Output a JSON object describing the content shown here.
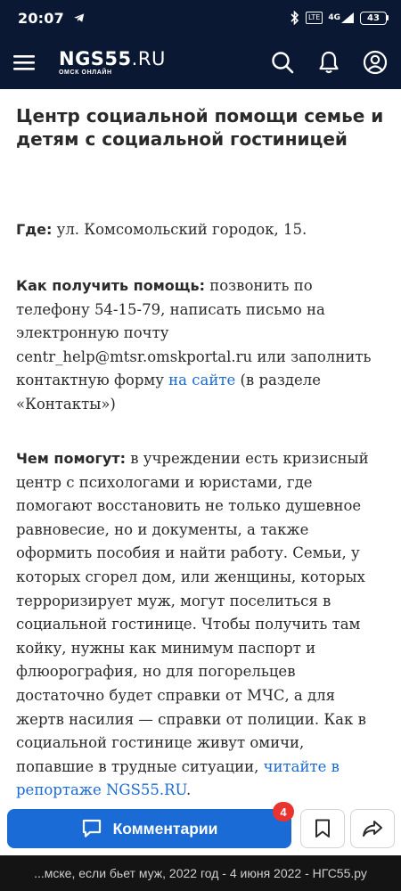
{
  "status_bar": {
    "time": "20:07",
    "network": "4G",
    "lte": "LTE",
    "battery": "43"
  },
  "header": {
    "logo_main": "NGS55",
    "logo_suffix": ".RU",
    "logo_sub": "ОМСК ОНЛАЙН"
  },
  "article": {
    "title": "Центр социальной помощи семье и детям с социальной гостиницей",
    "where_label": "Где:",
    "where_text": " ул. Комсомольский городок, 15.",
    "how_label": "Как получить помощь:",
    "how_text": " позвонить по телефону 54-15-79, написать письмо на электронную почту centr_help@mtsr.omskportal.ru или заполнить контактную форму ",
    "how_link": "на сайте",
    "how_text_end": " (в разделе «Контакты»)",
    "what_label": "Чем помогут:",
    "what_text": " в учреждении есть кризисный центр с психологами и юристами, где помогают восстановить не только душевное равновесие, но и документы, а также оформить пособия и найти работу. Семьи, у которых сгорел дом, или женщины, которых терроризирует муж, могут поселиться в социальной гостинице. Чтобы получить там койку, нужны как минимум паспорт и флюорография, но для погорельцев достаточно будет справки от МЧС, а для жертв насилия — справки от полиции. Как в социальной гостинице живут омичи, попавшие в трудные ситуации, ",
    "what_link": "читайте в репортаже NGS55.RU",
    "what_text_end": "."
  },
  "bottom_bar": {
    "comments_label": "Комментарии",
    "comments_count": "4"
  },
  "browser_bar": {
    "title": "...мске, если бьет муж, 2022 год - 4 июня 2022 - НГС55.ру"
  },
  "colors": {
    "header_bg": "#0b1833",
    "accent": "#1a6bd6",
    "badge": "#e8332f"
  }
}
